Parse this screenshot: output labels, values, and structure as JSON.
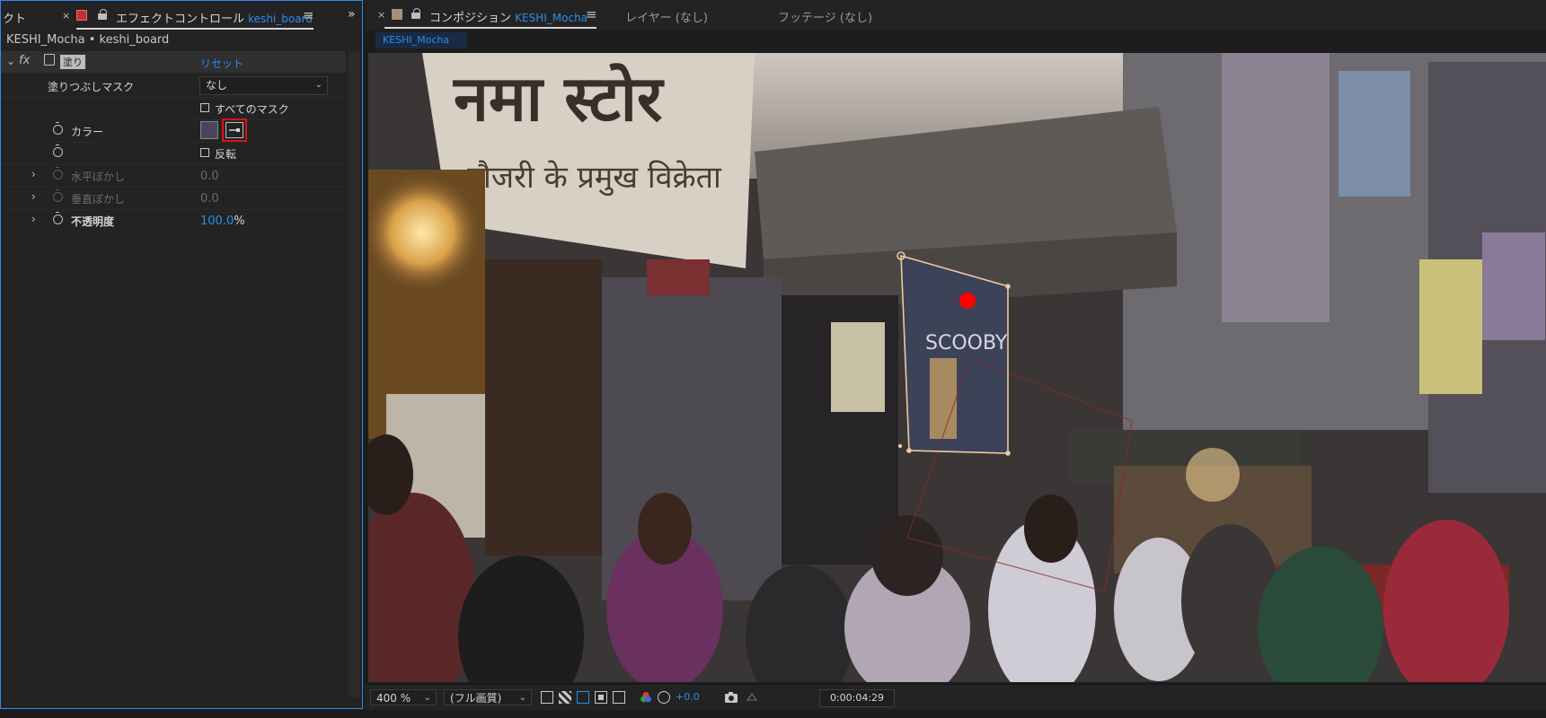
{
  "left_panel": {
    "tab_prev": "クト",
    "tab_title": "エフェクトコントロール",
    "tab_layer": "keshi_board",
    "expand_icon": "»",
    "breadcrumb": "KESHI_Mocha • keshi_board",
    "effect_name": "塗り",
    "fx_label": "fx",
    "reset_label": "リセット",
    "rows": {
      "fill_mask": {
        "label": "塗りつぶしマスク",
        "value": "なし"
      },
      "all_masks": {
        "label": "すべてのマスク"
      },
      "color": {
        "label": "カラー",
        "swatch": "#4a4558"
      },
      "invert": {
        "label": "反転"
      },
      "h_feather": {
        "label": "水平ぼかし",
        "value": "0.0"
      },
      "v_feather": {
        "label": "垂直ぼかし",
        "value": "0.0"
      },
      "opacity": {
        "label": "不透明度",
        "value": "100.0",
        "unit": "%"
      }
    }
  },
  "right_panel": {
    "tab_title": "コンポジション",
    "tab_comp": "KESHI_Mocha",
    "layer_tab": "レイヤー (なし)",
    "footage_tab": "フッテージ (なし)",
    "comp_chip": "KESHI_Mocha",
    "zoom": "400 %",
    "quality": "(フル画質)",
    "exposure": "+0.0",
    "timecode": "0:00:04:29"
  },
  "colors": {
    "accent": "#2d8ceb",
    "highlight_box": "#e01010",
    "mask_path": "#f0c8a0",
    "red_dot": "#ff0000"
  }
}
